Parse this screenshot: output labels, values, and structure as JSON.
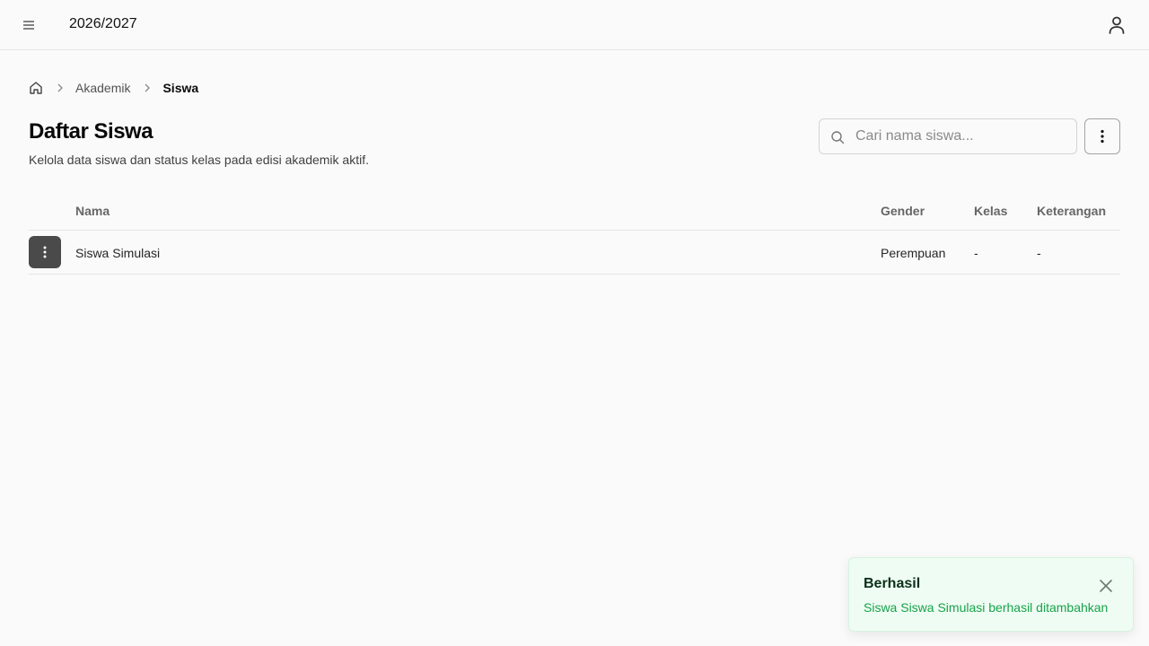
{
  "header": {
    "academic_year": "2026/2027",
    "menu_icon": "hamburger-icon",
    "user_icon": "user-icon"
  },
  "breadcrumb": {
    "home_icon": "home-icon",
    "items": [
      "Akademik",
      "Siswa"
    ]
  },
  "page": {
    "title": "Daftar Siswa",
    "subtitle": "Kelola data siswa dan status kelas pada edisi akademik aktif."
  },
  "search": {
    "placeholder": "Cari nama siswa...",
    "value": ""
  },
  "table": {
    "columns": [
      "Nama",
      "Gender",
      "Kelas",
      "Keterangan"
    ],
    "rows": [
      {
        "nama": "Siswa Simulasi",
        "gender": "Perempuan",
        "kelas": "-",
        "keterangan": "-"
      }
    ]
  },
  "toast": {
    "title": "Berhasil",
    "message": "Siswa Siswa Simulasi berhasil ditambahkan"
  },
  "colors": {
    "accent_dark": "#4a4a4a",
    "success_text": "#16a34a",
    "success_bg": "#effcf3"
  }
}
